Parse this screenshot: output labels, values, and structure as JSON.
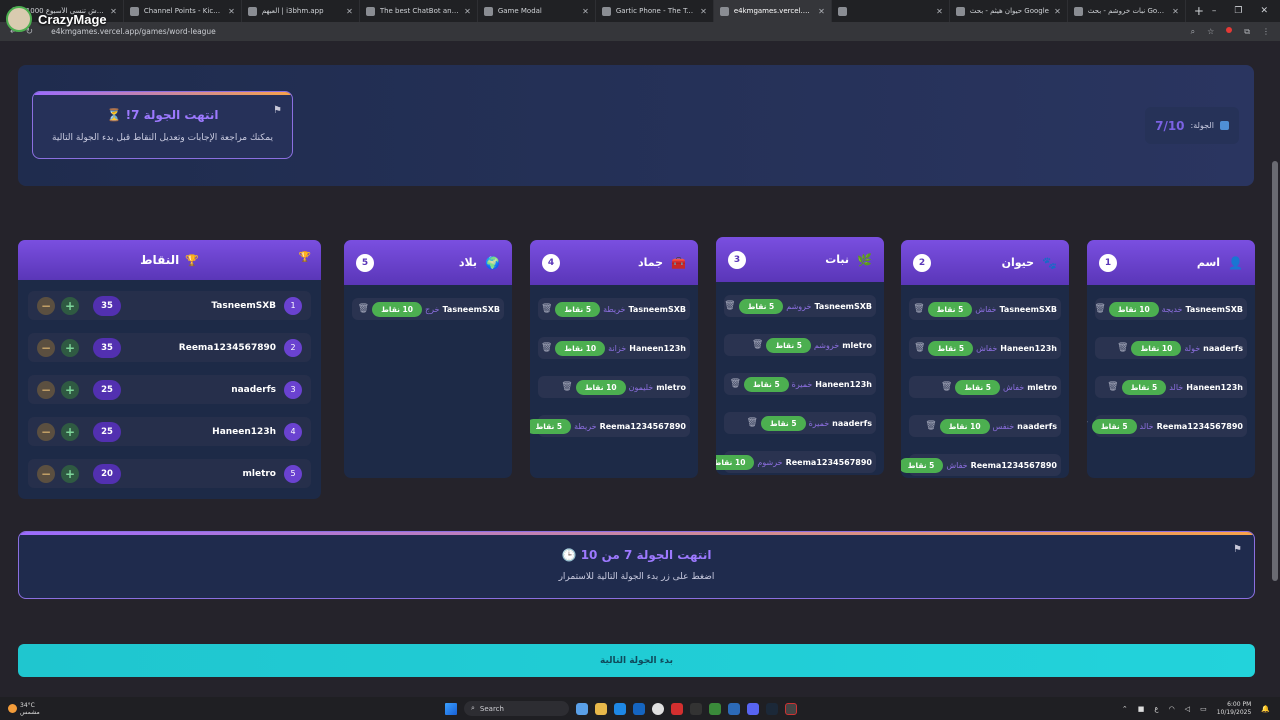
{
  "browser": {
    "tabs": [
      {
        "label": "بلاش تنسى الأسبوع 1000 -"
      },
      {
        "label": "Channel Points - Kick Dashboard"
      },
      {
        "label": "العبهم | i3bhm.app"
      },
      {
        "label": "The best ChatBot and Widgets"
      },
      {
        "label": "Game Modal"
      },
      {
        "label": "Gartic Phone - The Telephone"
      },
      {
        "label": "e4kmgames.vercel.app/games/"
      },
      {
        "label": ""
      },
      {
        "label": "حيوان هيثم - بحث Google"
      },
      {
        "label": "نبات خروشم - بحث Google"
      }
    ],
    "active_tab": 6,
    "url": "e4kmgames.vercel.app/games/word-league",
    "new_tab": "+",
    "window_controls": [
      "–",
      "❐",
      "✕"
    ]
  },
  "overlay": {
    "channel_name": "CrazyMage"
  },
  "round_end": {
    "title": "انتهت الجولة 7!",
    "subtitle": "يمكنك مراجعة الإجابات وتعديل النقاط قبل بدء الجولة التالية",
    "hourglass": "⏳"
  },
  "round_counter": {
    "label": "الجولة:",
    "value": "7/10"
  },
  "categories": [
    {
      "title": "اسم",
      "number": "1",
      "icon": "👤",
      "entries": [
        {
          "player": "TasneemSXB",
          "word": "خديجة",
          "points": "10 نقاط"
        },
        {
          "player": "naaderfs",
          "word": "خولة",
          "points": "10 نقاط"
        },
        {
          "player": "Haneen123h",
          "word": "خالد",
          "points": "5 نقاط"
        },
        {
          "player": "Reema1234567890",
          "word": "خالد",
          "points": "5 نقاط"
        }
      ]
    },
    {
      "title": "حيوان",
      "number": "2",
      "icon": "🐾",
      "entries": [
        {
          "player": "TasneemSXB",
          "word": "خفاش",
          "points": "5 نقاط"
        },
        {
          "player": "Haneen123h",
          "word": "خفاش",
          "points": "5 نقاط"
        },
        {
          "player": "mletro",
          "word": "خفاش",
          "points": "5 نقاط"
        },
        {
          "player": "naaderfs",
          "word": "خنفس",
          "points": "10 نقاط"
        },
        {
          "player": "Reema1234567890",
          "word": "خفاش",
          "points": "5 نقاط"
        }
      ]
    },
    {
      "title": "نبات",
      "number": "3",
      "icon": "🌿",
      "entries": [
        {
          "player": "TasneemSXB",
          "word": "خروشم",
          "points": "5 نقاط"
        },
        {
          "player": "mletro",
          "word": "خروشم",
          "points": "5 نقاط"
        },
        {
          "player": "Haneen123h",
          "word": "خميرة",
          "points": "5 نقاط"
        },
        {
          "player": "naaderfs",
          "word": "خميرة",
          "points": "5 نقاط"
        },
        {
          "player": "Reema1234567890",
          "word": "خرشوم",
          "points": "10 نقاط"
        }
      ]
    },
    {
      "title": "جماد",
      "number": "4",
      "icon": "🧰",
      "entries": [
        {
          "player": "TasneemSXB",
          "word": "خريطة",
          "points": "5 نقاط"
        },
        {
          "player": "Haneen123h",
          "word": "خزانة",
          "points": "10 نقاط"
        },
        {
          "player": "mletro",
          "word": "خليمون",
          "points": "10 نقاط"
        },
        {
          "player": "Reema1234567890",
          "word": "خريطة",
          "points": "5 نقاط"
        }
      ]
    },
    {
      "title": "بلاد",
      "number": "5",
      "icon": "🌍",
      "entries": [
        {
          "player": "TasneemSXB",
          "word": "خرج",
          "points": "10 نقاط"
        }
      ]
    }
  ],
  "scores": {
    "title": "النقاط",
    "icon": "🏆",
    "rows": [
      {
        "rank": "1",
        "name": "TasneemSXB",
        "score": "35"
      },
      {
        "rank": "2",
        "name": "Reema1234567890",
        "score": "35"
      },
      {
        "rank": "3",
        "name": "naaderfs",
        "score": "25"
      },
      {
        "rank": "4",
        "name": "Haneen123h",
        "score": "25"
      },
      {
        "rank": "5",
        "name": "mletro",
        "score": "20"
      }
    ],
    "minus": "−",
    "plus": "+"
  },
  "bottom_banner": {
    "title": "انتهت الجولة 7 من 10",
    "subtitle": "اضغط على زر بدء الجولة التالية للاستمرار",
    "icon": "🕒"
  },
  "next_button": {
    "label": "بدء الجولة التالية"
  },
  "taskbar": {
    "weather_temp": "34°C",
    "weather_desc": "مشمس",
    "search_label": "Search",
    "lang": "ع",
    "time": "6:00 PM",
    "date": "10/19/2025"
  },
  "colors": {
    "accent": "#6a42d0",
    "points_green": "#4caf50",
    "next_button": "#22d3db"
  }
}
